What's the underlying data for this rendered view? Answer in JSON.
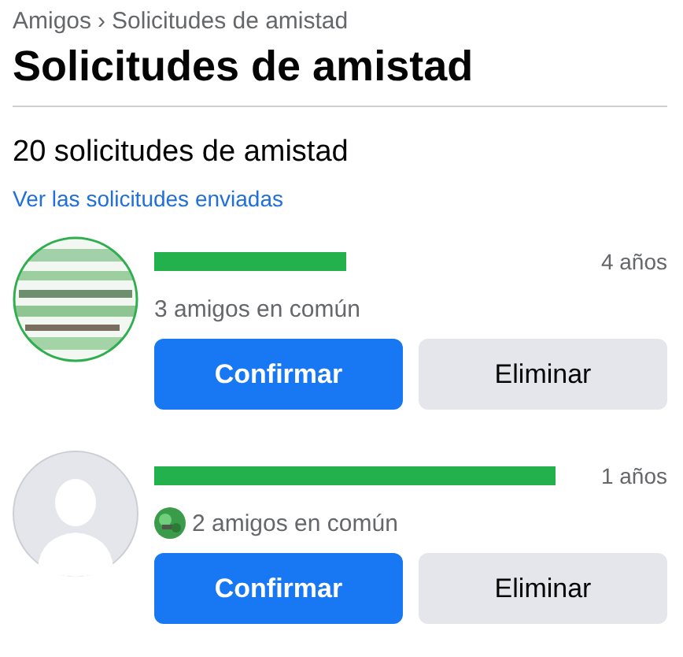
{
  "breadcrumb": {
    "parent": "Amigos",
    "separator": "›",
    "current": "Solicitudes de amistad"
  },
  "title": "Solicitudes de amistad",
  "count_heading": "20 solicitudes de amistad",
  "sent_link": "Ver las solicitudes enviadas",
  "requests": [
    {
      "time": "4 años",
      "mutual_avatar": false,
      "mutual": "3 amigos en común",
      "confirm": "Confirmar",
      "delete": "Eliminar"
    },
    {
      "avatar": {
        "kind": "default"
      },
      "time": "1 años",
      "mutual_avatar": true,
      "mutual": "2 amigos en común",
      "confirm": "Confirmar",
      "delete": "Eliminar"
    }
  ]
}
